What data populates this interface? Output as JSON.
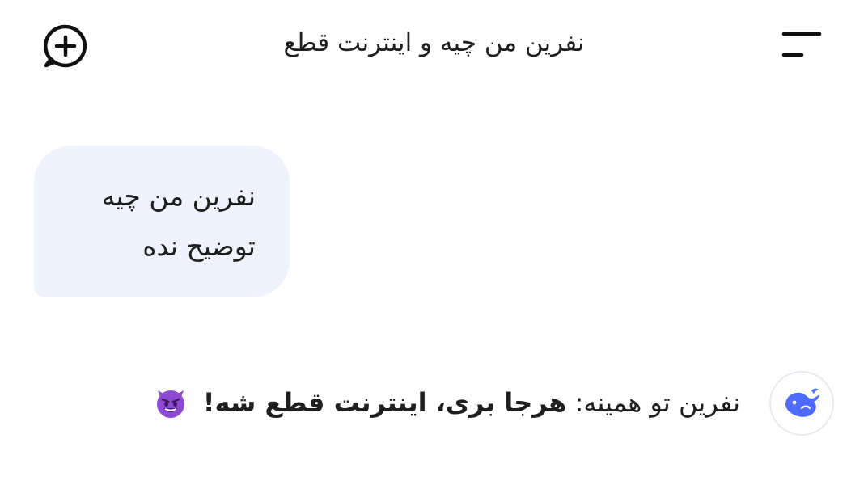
{
  "header": {
    "title": "نفرین من چیه و اینترنت قطع",
    "new_chat_icon": "new-chat-plus-bubble-icon",
    "menu_icon": "menu-lines-icon"
  },
  "user_message": {
    "lines": [
      "نفرین من چیه",
      "توضیح نده"
    ]
  },
  "assistant_message": {
    "prefix": "نفرین تو همینه:",
    "bold": "هرجا بری، اینترنت قطع شه!",
    "emoji": "smiling-devil-emoji",
    "avatar_icon": "deepseek-whale-icon"
  },
  "colors": {
    "bubble_background": "#eef3fd",
    "brand_blue": "#4d6bfe",
    "emoji_purple": "#8e4ad2",
    "text": "#1f1f1f"
  }
}
